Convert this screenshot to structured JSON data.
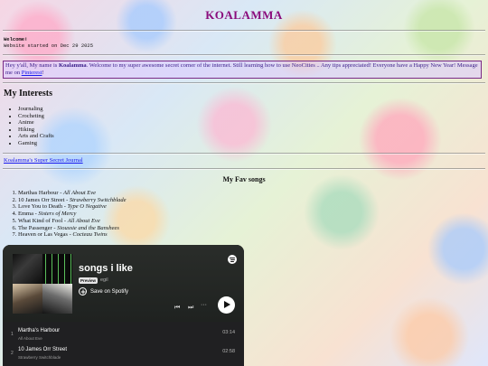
{
  "site": {
    "title": "KOALAMMA",
    "welcome": "Welcome!",
    "started": "Website started on Dec 29 2025"
  },
  "intro": {
    "prefix": "Hey y'all, My name is ",
    "name": "Koalamma",
    "body": ". Welcome to my super awesome secret corner of the internet. Still learning how to use NeoCities .. Any tips appreciated! Everyone have a Happy New Year! Message me on ",
    "link_label": "Pinterest",
    "suffix": "!"
  },
  "interests": {
    "title": "My Interests",
    "items": [
      "Journaling",
      "Crocheting",
      "Anime",
      "Hiking",
      "Arts and Crafts",
      "Gaming"
    ]
  },
  "journal_link": "Koalamma's Super Secret Journal",
  "songs": {
    "title": "My Fav songs",
    "items": [
      {
        "song": "Marthas Harbour",
        "artist": "All About Eve"
      },
      {
        "song": "10 James Orr Street",
        "artist": "Strawberry Switchblade"
      },
      {
        "song": "Love You to Death",
        "artist": "Type O Negative"
      },
      {
        "song": "Emma",
        "artist": "Sisters of Mercy"
      },
      {
        "song": "What Kind of Fool",
        "artist": "All About Eve"
      },
      {
        "song": "The Passenger",
        "artist": "Siouxsie and the Banshees"
      },
      {
        "song": "Heaven or Las Vegas",
        "artist": "Cocteau Twins"
      }
    ]
  },
  "spotify": {
    "playlist_title": "songs i like",
    "badge": "Preview",
    "owner": "egil",
    "save_label": "Save on Spotify",
    "more_label": "···",
    "tracks": [
      {
        "num": "1",
        "name": "Martha's Harbour",
        "artist": "All About Eve",
        "duration": "03:14"
      },
      {
        "num": "2",
        "name": "10 James Orr Street",
        "artist": "Strawberry Switchblade",
        "duration": "02:58"
      }
    ],
    "colors": {
      "background": "#202022",
      "header": "#2a2d2a",
      "accent": "#1ed760"
    }
  }
}
